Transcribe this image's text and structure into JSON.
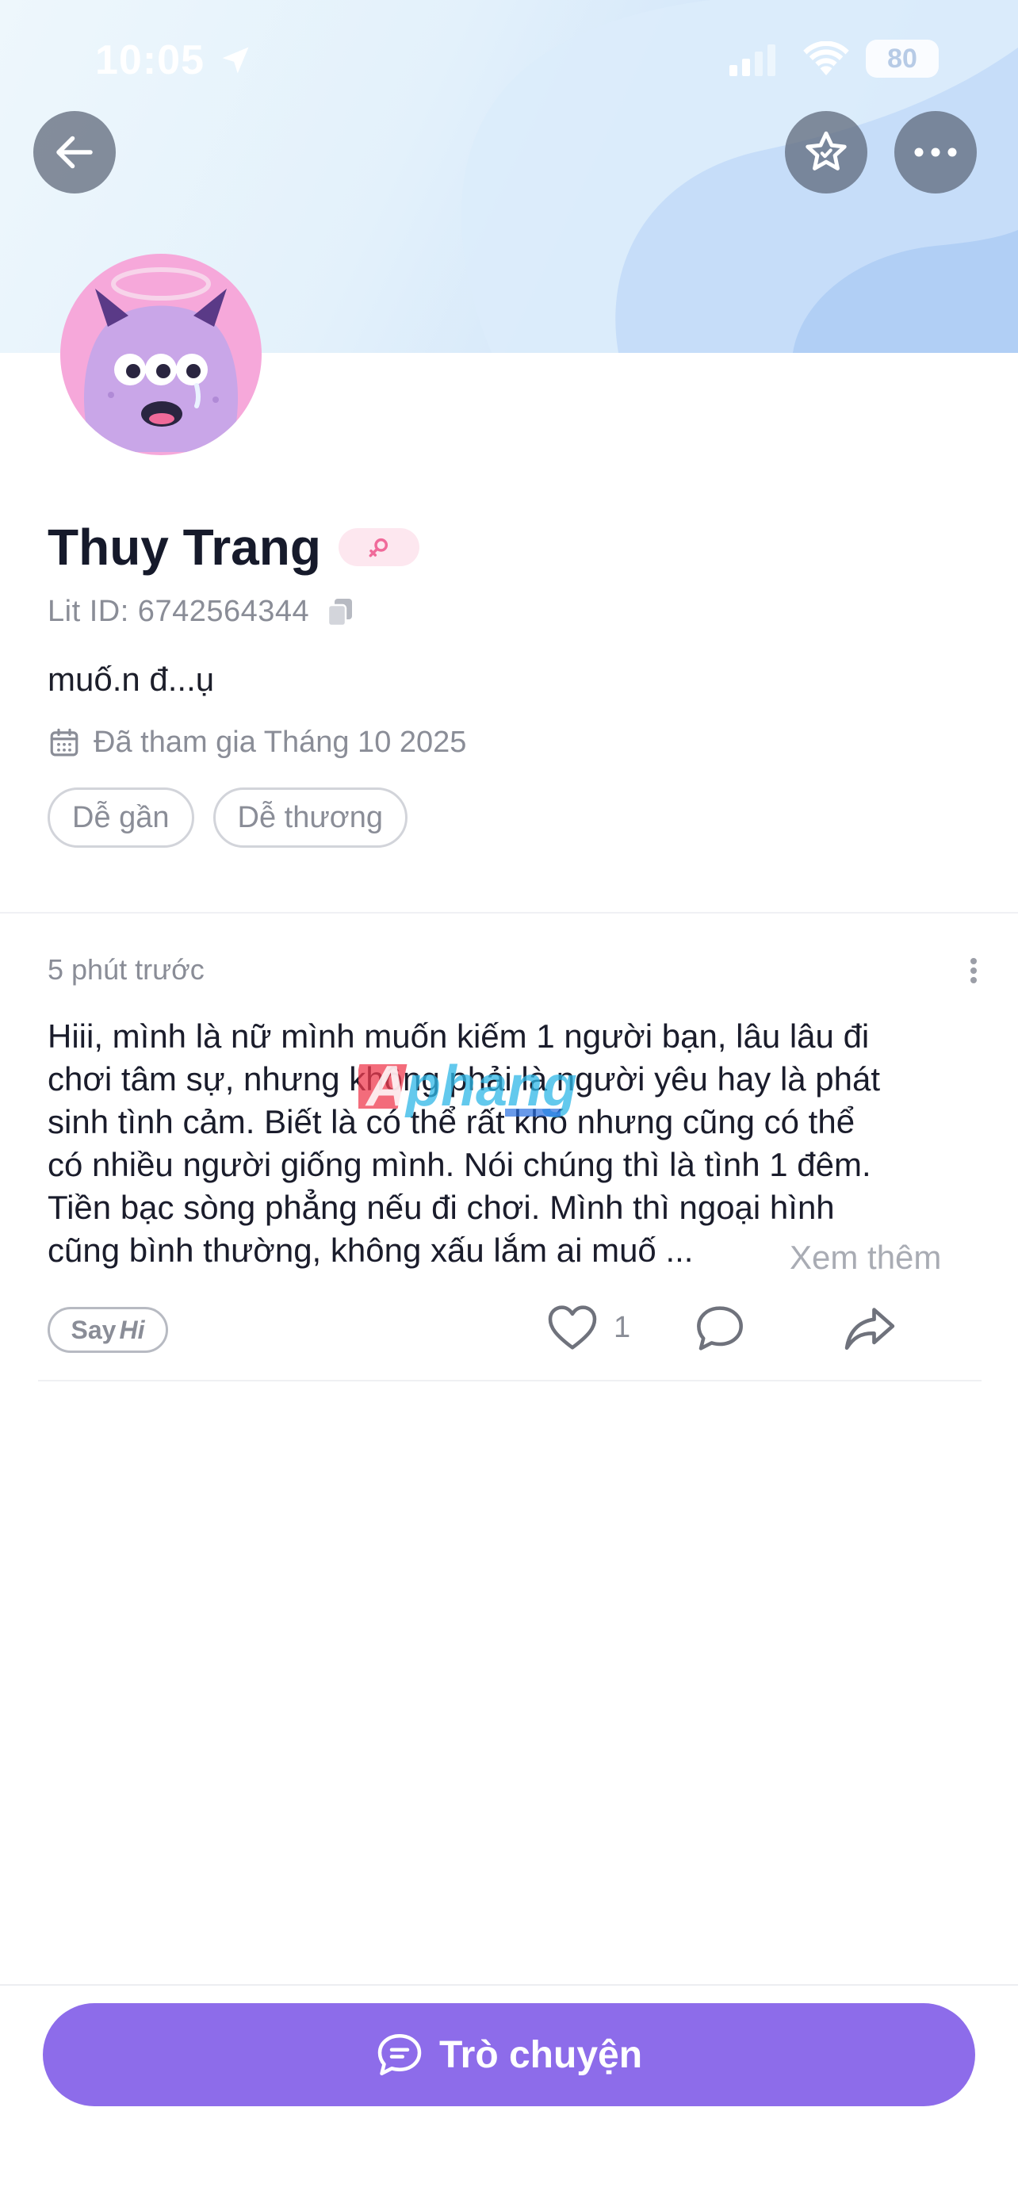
{
  "status_bar": {
    "time": "10:05",
    "battery": "80",
    "icons": [
      "location-arrow-icon",
      "cellular-signal-icon",
      "wifi-icon",
      "battery-icon"
    ]
  },
  "header": {
    "buttons": [
      "back-arrow-icon",
      "star-icon",
      "more-dots-icon"
    ]
  },
  "profile": {
    "name": "Thuy Trang",
    "gender_icon": "female-icon",
    "lit_id": "Lit ID: 6742564344",
    "bio": "muố.n đ...ụ",
    "joined": "Đã tham gia Tháng 10 2025",
    "tags": [
      "Dễ gần",
      "Dễ thương"
    ]
  },
  "post": {
    "time": "5 phút trước",
    "text_lines": [
      "Hiii, mình là nữ mình muốn kiếm 1 người bạn, lâu lâu đi",
      "chơi tâm sự, nhưng không phải là người yêu hay là phát",
      "sinh tình cảm. Biết là có thể rất khó nhưng cũng có thể",
      "có nhiều người giống mình. Nói chúng thì là tình 1 đêm.",
      "Tiền bạc sòng phẳng nếu đi chơi. Mình thì ngoại hình",
      "cũng bình thường, không xấu lắm ai muố ..."
    ],
    "see_more": "Xem thêm",
    "say_hi": {
      "say": "Say",
      "hi": "Hi"
    },
    "like_count": "1",
    "watermark": "Aphang"
  },
  "footer": {
    "chat_button": "Trò chuyện"
  },
  "colors": {
    "accent": "#8d6cea",
    "female_pink": "#f06a9a",
    "avatar_bg": "#f6a8da",
    "avatar_monster": "#c9a6e8"
  }
}
